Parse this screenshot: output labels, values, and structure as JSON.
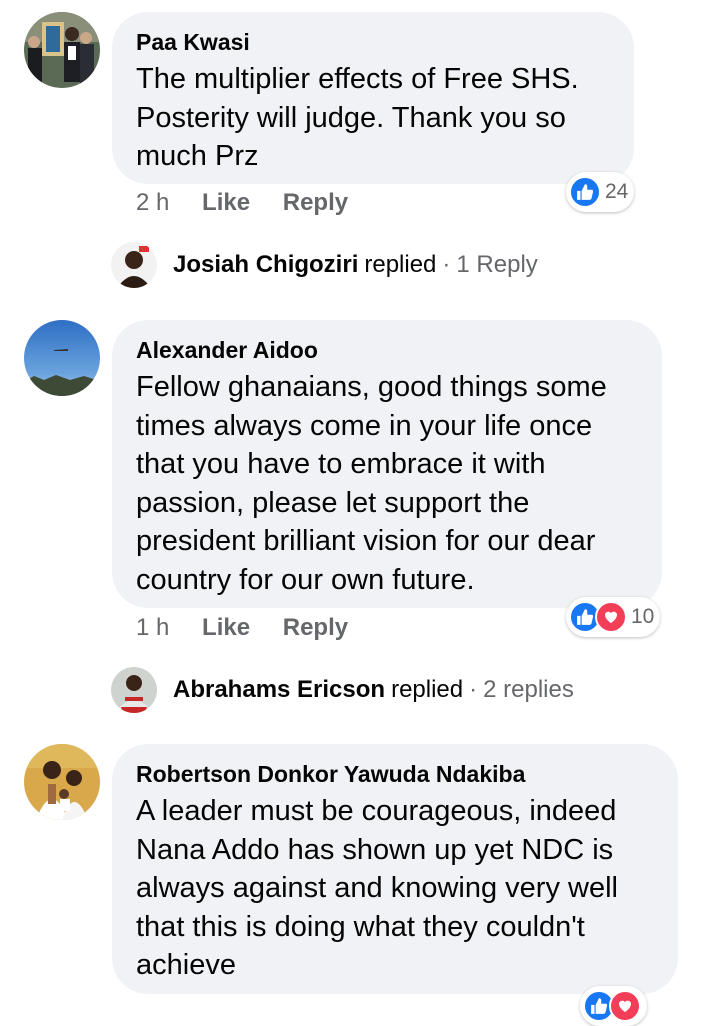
{
  "comments": [
    {
      "author": "Paa Kwasi",
      "text": "The multiplier effects of Free SHS. Posterity will judge. Thank you so much Prz",
      "time": "2 h",
      "like_label": "Like",
      "reply_label": "Reply",
      "reaction_count": "24",
      "reactions": [
        "like"
      ]
    },
    {
      "author": "Alexander Aidoo",
      "text": "Fellow ghanaians, good things some times always come in your life once that you have to embrace it with passion, please let support the president brilliant vision for our dear country for our own future.",
      "time": "1 h",
      "like_label": "Like",
      "reply_label": "Reply",
      "reaction_count": "10",
      "reactions": [
        "like",
        "love"
      ]
    },
    {
      "author": "Robertson Donkor Yawuda Ndakiba",
      "text": "A leader must be courageous, indeed Nana Addo has shown up yet NDC is always against and knowing very well that this is doing what they couldn't achieve",
      "reactions": [
        "like",
        "love"
      ]
    }
  ],
  "replies": [
    {
      "name": "Josiah Chigoziri",
      "verb": "replied",
      "dot": "·",
      "count": "1 Reply"
    },
    {
      "name": "Abrahams Ericson",
      "verb": "replied",
      "dot": "·",
      "count": "2 replies"
    }
  ],
  "colors": {
    "bubble": "#f0f2f5",
    "secondary_text": "#65676b",
    "like_blue": "#1877f2",
    "love_red": "#f33e58"
  }
}
